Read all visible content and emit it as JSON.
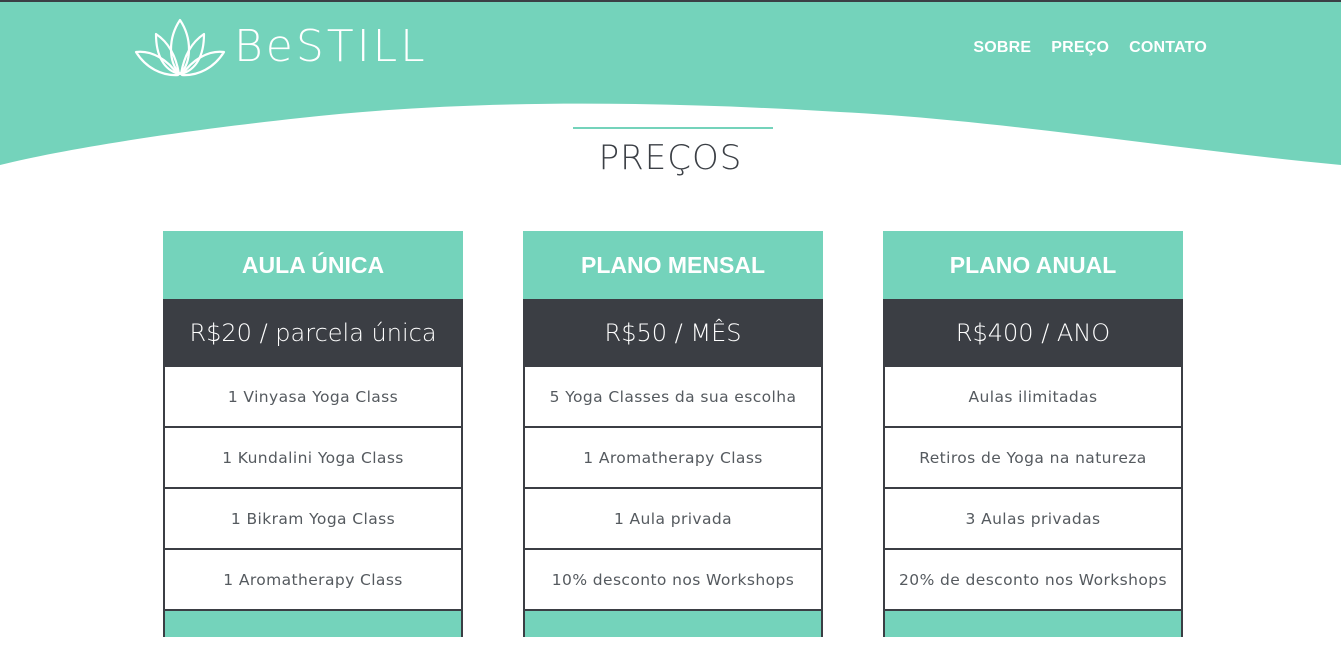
{
  "colors": {
    "accent": "#74d3bb",
    "dark": "#3b3e44",
    "text": "#555a5f",
    "white": "#ffffff"
  },
  "header": {
    "logo_text": "BeSTILL",
    "logo_icon": "lotus-icon",
    "nav": [
      "SOBRE",
      "PREÇO",
      "CONTATO"
    ]
  },
  "section": {
    "title": "PREÇOS"
  },
  "plans": [
    {
      "name": "AULA ÚNICA",
      "price": "R$20 / parcela única",
      "features": [
        "1 Vinyasa Yoga Class",
        "1 Kundalini Yoga Class",
        "1 Bikram Yoga Class",
        "1 Aromatherapy Class"
      ]
    },
    {
      "name": "PLANO MENSAL",
      "price": "R$50 / MÊS",
      "features": [
        "5 Yoga Classes da sua escolha",
        "1 Aromatherapy Class",
        "1 Aula privada",
        "10% desconto nos Workshops"
      ]
    },
    {
      "name": "PLANO ANUAL",
      "price": "R$400 / ANO",
      "features": [
        "Aulas ilimitadas",
        "Retiros de Yoga na natureza",
        "3 Aulas privadas",
        "20% de desconto nos Workshops"
      ]
    }
  ]
}
